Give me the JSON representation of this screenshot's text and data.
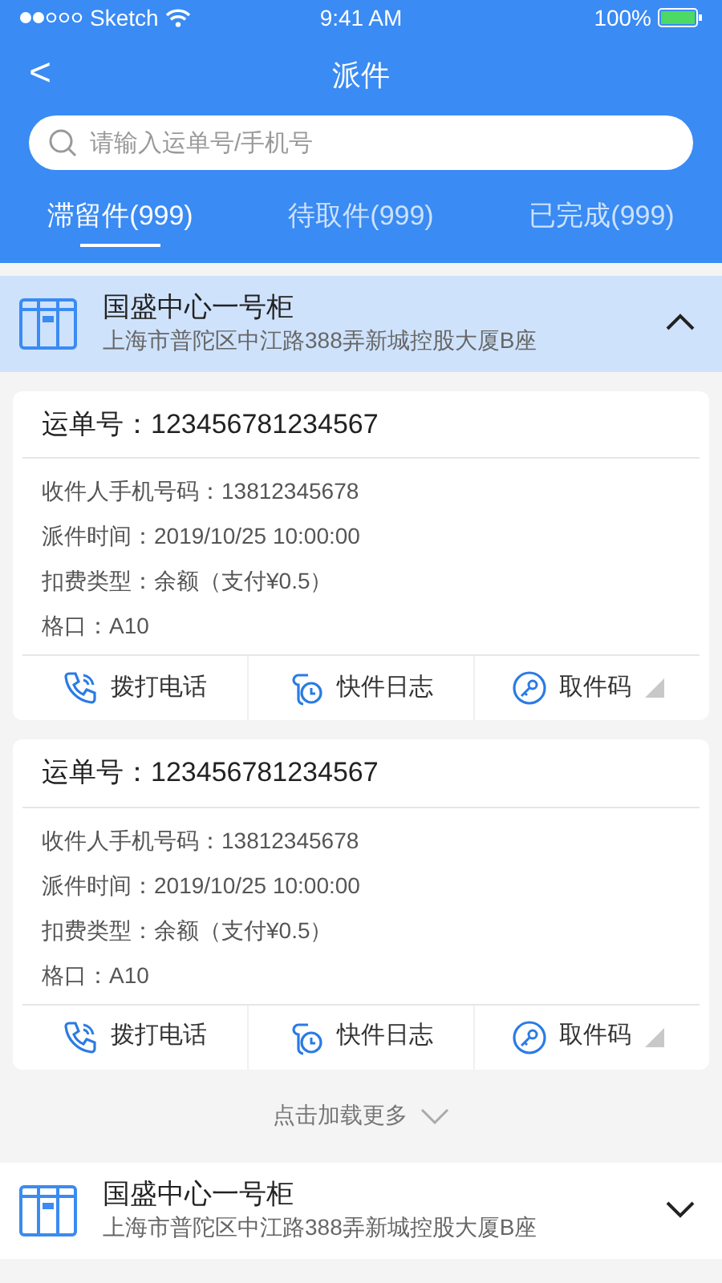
{
  "status_bar": {
    "carrier": "Sketch",
    "time": "9:41 AM",
    "battery": "100%"
  },
  "nav": {
    "back": "<",
    "title": "派件"
  },
  "search": {
    "placeholder": "请输入运单号/手机号"
  },
  "tabs": [
    {
      "label": "滞留件(999)",
      "selected": true
    },
    {
      "label": "待取件(999)",
      "selected": false
    },
    {
      "label": "已完成(999)",
      "selected": false
    }
  ],
  "lockers": [
    {
      "name": "国盛中心一号柜",
      "address": "上海市普陀区中江路388弄新城控股大厦B座",
      "expanded": true,
      "parcels": [
        {
          "waybill": "运单号：123456781234567",
          "fields": [
            "收件人手机号码：13812345678",
            "派件时间：2019/10/25  10:00:00",
            "扣费类型：余额（支付¥0.5）",
            "格口：A10"
          ],
          "actions": [
            {
              "kind": "phone",
              "label": "拨打电话"
            },
            {
              "kind": "log",
              "label": "快件日志"
            },
            {
              "kind": "code",
              "label": "取件码"
            }
          ]
        },
        {
          "waybill": "运单号：123456781234567",
          "fields": [
            "收件人手机号码：13812345678",
            "派件时间：2019/10/25  10:00:00",
            "扣费类型：余额（支付¥0.5）",
            "格口：A10"
          ],
          "actions": [
            {
              "kind": "phone",
              "label": "拨打电话"
            },
            {
              "kind": "log",
              "label": "快件日志"
            },
            {
              "kind": "code",
              "label": "取件码"
            }
          ]
        }
      ],
      "load_more": "点击加载更多"
    },
    {
      "name": "国盛中心一号柜",
      "address": "上海市普陀区中江路388弄新城控股大厦B座",
      "expanded": false
    }
  ]
}
